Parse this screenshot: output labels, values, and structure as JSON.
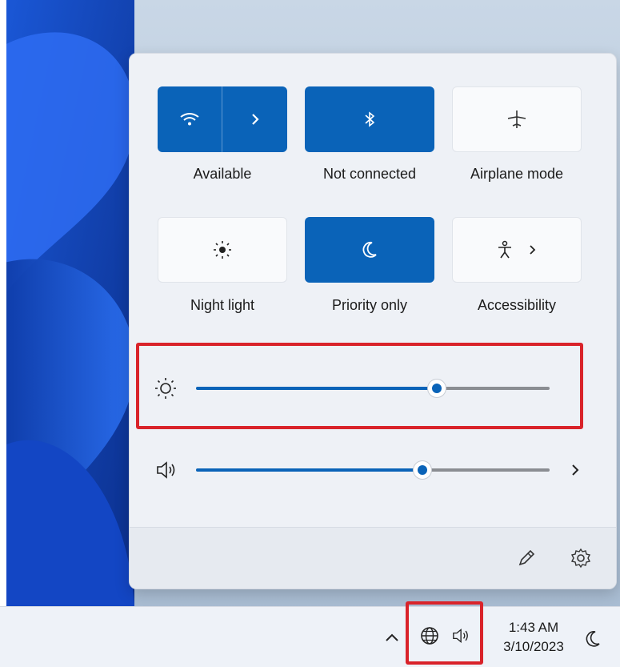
{
  "quick_settings": {
    "tiles": [
      {
        "label": "Available",
        "icon": "wifi-icon",
        "active": true
      },
      {
        "label": "Not connected",
        "icon": "bluetooth-icon",
        "active": true
      },
      {
        "label": "Airplane mode",
        "icon": "airplane-icon",
        "active": false
      },
      {
        "label": "Night light",
        "icon": "brightness-icon",
        "active": false
      },
      {
        "label": "Priority only",
        "icon": "moon-icon",
        "active": true
      },
      {
        "label": "Accessibility",
        "icon": "accessibility-icon",
        "active": false
      }
    ],
    "brightness": {
      "icon": "brightness-icon",
      "value_percent": 68
    },
    "volume": {
      "icon": "speaker-icon",
      "value_percent": 64
    },
    "footer": {
      "edit_icon": "pencil-icon",
      "settings_icon": "gear-icon"
    }
  },
  "taskbar": {
    "time": "1:43 AM",
    "date": "3/10/2023",
    "icons": [
      "chevron-up-icon",
      "globe-icon",
      "speaker-icon",
      "moon-icon"
    ]
  },
  "colors": {
    "accent": "#0a63b8",
    "highlight": "#d9232a"
  }
}
